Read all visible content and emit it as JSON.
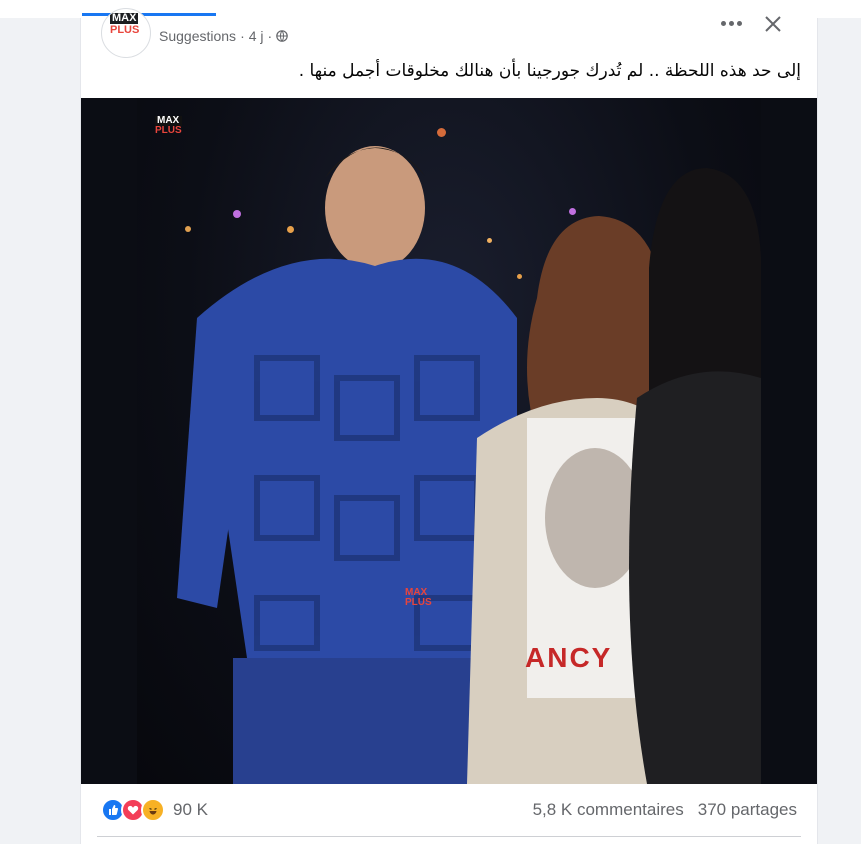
{
  "post": {
    "meta": {
      "audience": "Suggestions",
      "separator": "·",
      "time": "4 j",
      "separator2": "·",
      "audience_icon": "globe-icon"
    },
    "avatar": {
      "line1": "MAX",
      "line2": "PLUS"
    },
    "menu_icon": "more-horizontal-icon",
    "close_icon": "close-icon",
    "text": "إلى حد هذه اللحظة .. لم تُدرك جورجينا بأن هنالك مخلوقات أجمل منها .",
    "image": {
      "watermark_top": {
        "line1": "MAX",
        "line2": "PLUS"
      },
      "watermark_center": {
        "line1": "MAX",
        "line2": "PLUS"
      },
      "shirt_text": "ANCY"
    },
    "stats": {
      "reactions_count": "90 K",
      "reaction_icons": [
        "like-icon",
        "love-icon",
        "haha-icon"
      ],
      "comments": "5,8 K commentaires",
      "shares": "370 partages"
    }
  },
  "colors": {
    "accent": "#1877f2",
    "like": "#1877f2",
    "love": "#f33e58",
    "haha": "#f7b125",
    "secondary_text": "#65676b"
  }
}
